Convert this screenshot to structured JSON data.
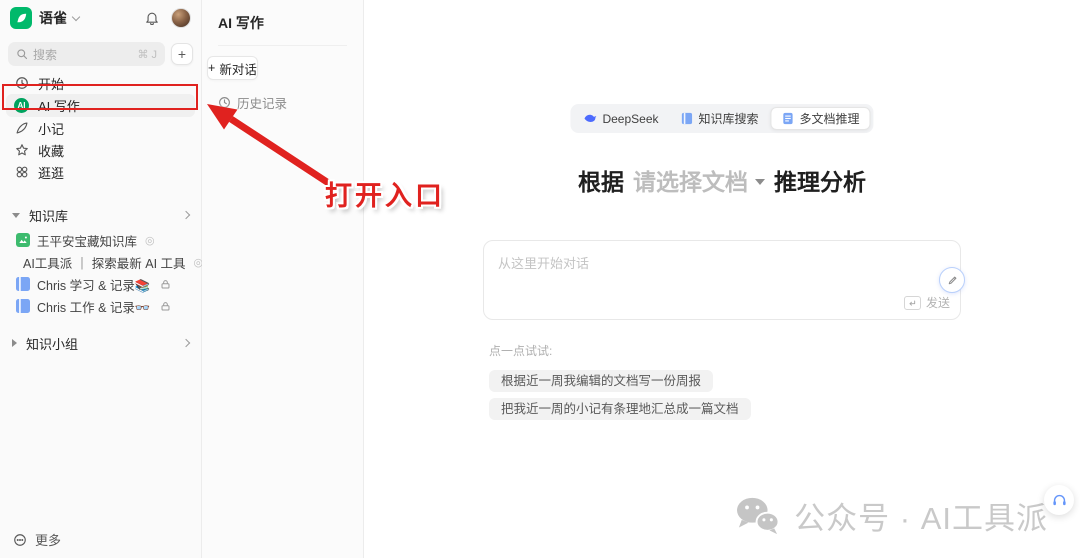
{
  "colors": {
    "brand_green": "#00b96b",
    "annotation_red": "#e0221f",
    "accent_blue": "#4d6bfe"
  },
  "sidebar": {
    "app_name": "语雀",
    "search": {
      "placeholder": "搜索",
      "shortcut": "⌘ J"
    },
    "nav": [
      {
        "label": "开始"
      },
      {
        "label": "AI 写作"
      },
      {
        "label": "小记"
      },
      {
        "label": "收藏"
      },
      {
        "label": "逛逛"
      }
    ],
    "kb": {
      "header": "知识库",
      "items": [
        {
          "label": "王平安宝藏知识库"
        },
        {
          "label": "AI工具派 ｜ 探索最新 AI 工具"
        },
        {
          "label": "Chris 学习 & 记录📚"
        },
        {
          "label": "Chris 工作 & 记录👓"
        }
      ]
    },
    "groups": {
      "header": "知识小组"
    },
    "more_label": "更多"
  },
  "panel": {
    "title": "AI 写作",
    "new_chat_label": "新对话",
    "history_label": "历史记录"
  },
  "main": {
    "mode_tabs": [
      {
        "label": "DeepSeek"
      },
      {
        "label": "知识库搜索"
      },
      {
        "label": "多文档推理"
      }
    ],
    "heading": {
      "prefix": "根据",
      "doc_select": "请选择文档",
      "suffix": "推理分析"
    },
    "input": {
      "placeholder": "从这里开始对话",
      "value": "",
      "send_label": "发送"
    },
    "try": {
      "label": "点一点试试:",
      "items": [
        {
          "text": "根据近一周我编辑的文档写一份周报"
        },
        {
          "text": "把我近一周的小记有条理地汇总成一篇文档"
        }
      ]
    }
  },
  "annotation": {
    "callout": "打开入口"
  },
  "watermark": {
    "text": "公众号 · AI工具派"
  },
  "glyphs": {
    "plus": "+",
    "public_badge": "◎",
    "ai_badge": "AI"
  }
}
